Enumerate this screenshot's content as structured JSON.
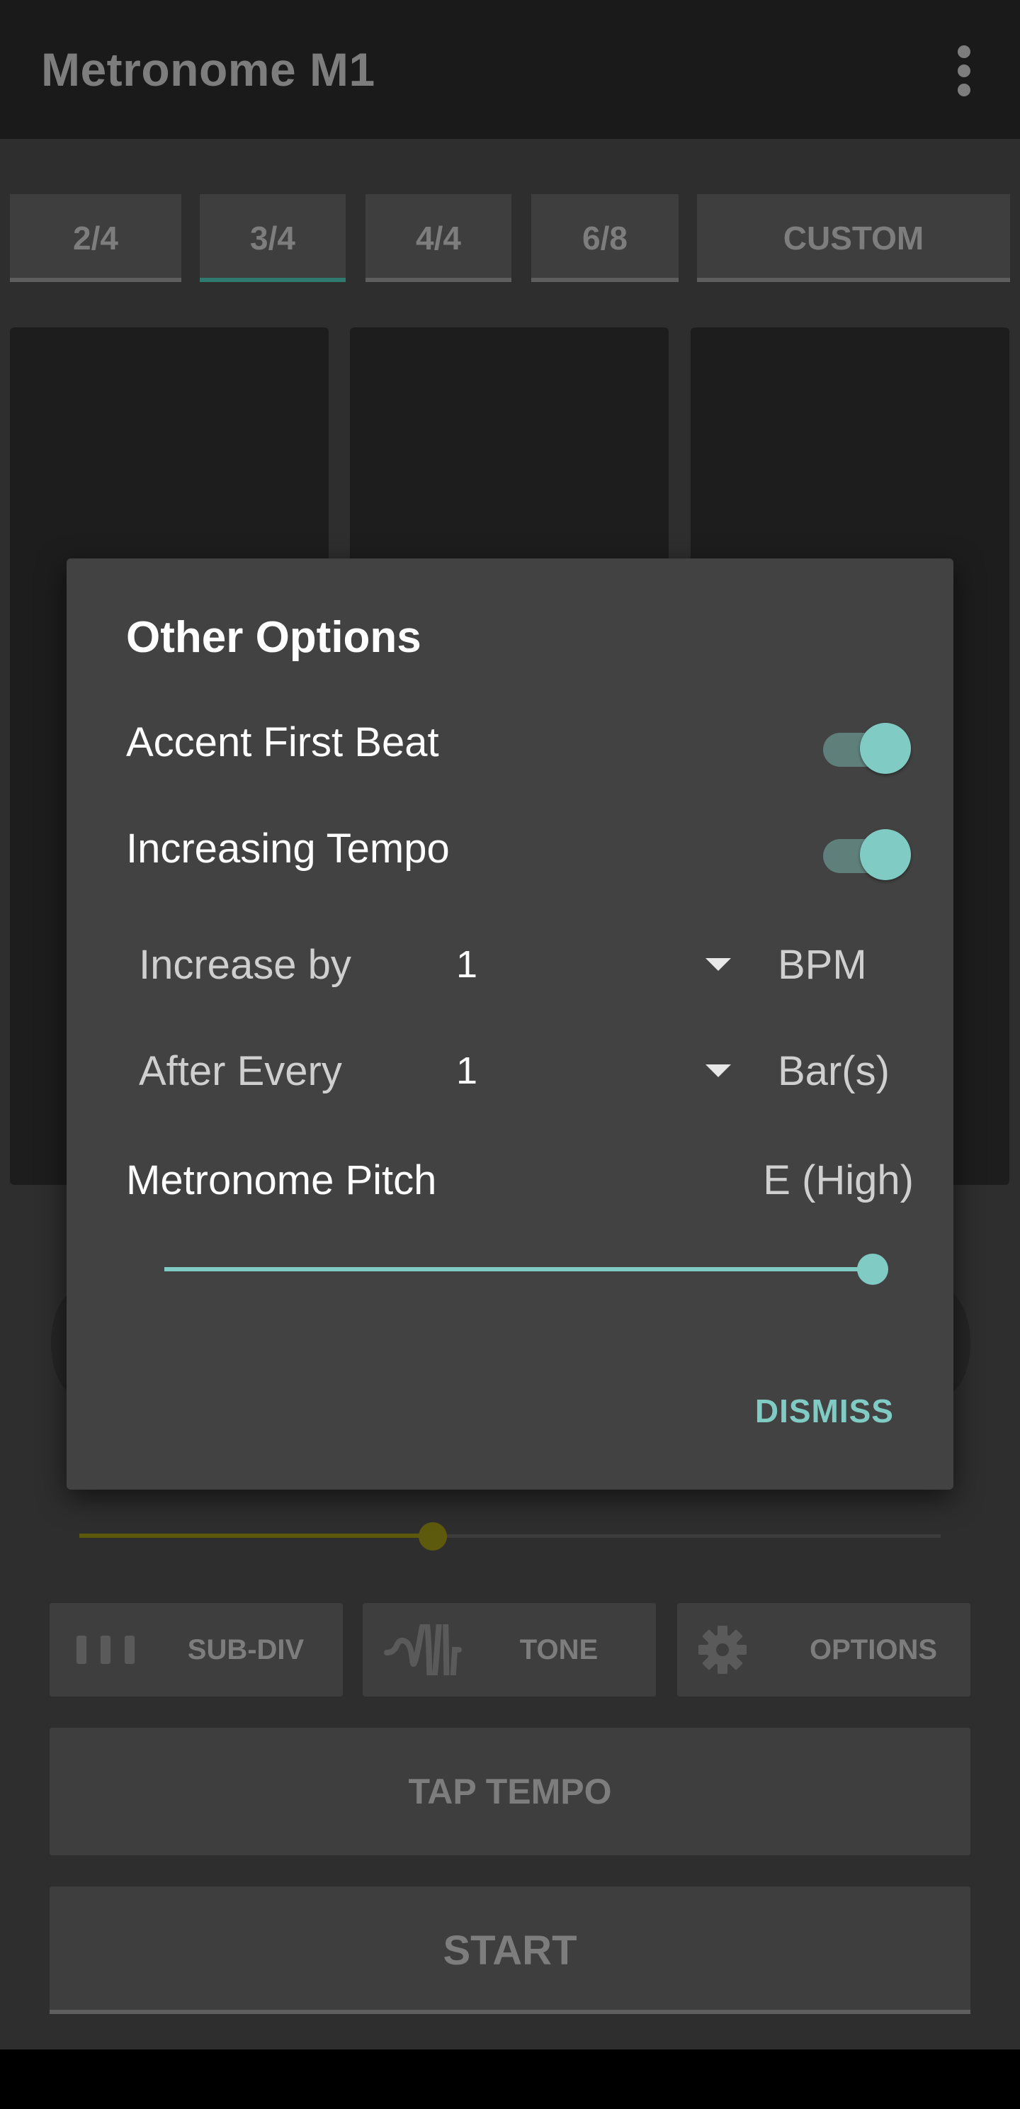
{
  "app": {
    "title": "Metronome M1"
  },
  "time_signatures": [
    {
      "label": "2/4",
      "active": false
    },
    {
      "label": "3/4",
      "active": true
    },
    {
      "label": "4/4",
      "active": false
    },
    {
      "label": "6/8",
      "active": false
    },
    {
      "label": "CUSTOM",
      "active": false
    }
  ],
  "tempo_slider": {
    "value_fraction": 0.41
  },
  "controls": {
    "subdiv_label": "SUB-DIV",
    "tone_label": "TONE",
    "options_label": "OPTIONS"
  },
  "actions": {
    "tap_tempo_label": "TAP TEMPO",
    "start_label": "START"
  },
  "dialog": {
    "title": "Other Options",
    "accent_first_beat": {
      "label": "Accent First Beat",
      "on": true
    },
    "increasing_tempo": {
      "label": "Increasing Tempo",
      "on": true
    },
    "increase_by": {
      "label": "Increase by",
      "value": "1",
      "unit": "BPM"
    },
    "after_every": {
      "label": "After Every",
      "value": "1",
      "unit": "Bar(s)"
    },
    "pitch": {
      "label": "Metronome Pitch",
      "value": "E (High)",
      "value_fraction": 1.0
    },
    "dismiss_label": "DISMISS"
  },
  "colors": {
    "accent": "#80cbc4",
    "tempo_accent": "#5e5a0d",
    "dialog_bg": "#424242"
  }
}
